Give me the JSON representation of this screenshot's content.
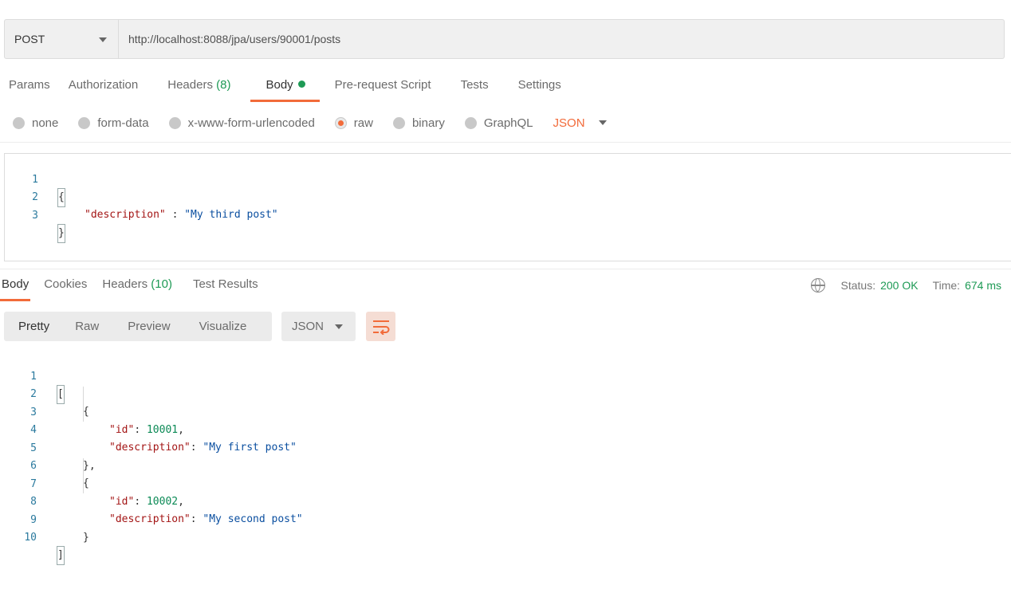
{
  "request": {
    "method": "POST",
    "url": "http://localhost:8088/jpa/users/90001/posts"
  },
  "request_tabs": [
    {
      "label": "Params"
    },
    {
      "label": "Authorization"
    },
    {
      "label": "Headers",
      "count": "(8)"
    },
    {
      "label": "Body"
    },
    {
      "label": "Pre-request Script"
    },
    {
      "label": "Tests"
    },
    {
      "label": "Settings"
    }
  ],
  "body_types": [
    {
      "label": "none"
    },
    {
      "label": "form-data"
    },
    {
      "label": "x-www-form-urlencoded"
    },
    {
      "label": "raw"
    },
    {
      "label": "binary"
    },
    {
      "label": "GraphQL"
    }
  ],
  "body_format": "JSON",
  "request_body": {
    "line_numbers": [
      "1",
      "2",
      "3"
    ],
    "open": "{",
    "key": "\"description\"",
    "sep": " : ",
    "value": "\"My third post\"",
    "close": "}"
  },
  "response_tabs": [
    {
      "label": "Body"
    },
    {
      "label": "Cookies"
    },
    {
      "label": "Headers",
      "count": "(10)"
    },
    {
      "label": "Test Results"
    }
  ],
  "response_meta": {
    "status_label": "Status:",
    "status_value": "200 OK",
    "time_label": "Time:",
    "time_value": "674 ms"
  },
  "view_modes": [
    {
      "label": "Pretty"
    },
    {
      "label": "Raw"
    },
    {
      "label": "Preview"
    },
    {
      "label": "Visualize"
    }
  ],
  "response_format": "JSON",
  "response_body": {
    "line_numbers": [
      "1",
      "2",
      "3",
      "4",
      "5",
      "6",
      "7",
      "8",
      "9",
      "10"
    ],
    "open_arr": "[",
    "open_obj": "{",
    "close_obj_comma": "},",
    "close_obj": "}",
    "close_arr": "]",
    "id_key": "\"id\"",
    "desc_key": "\"description\"",
    "colon": ": ",
    "comma": ",",
    "items": [
      {
        "id": "10001",
        "description": "\"My first post\""
      },
      {
        "id": "10002",
        "description": "\"My second post\""
      }
    ]
  },
  "colors": {
    "accent": "#f26b3a",
    "success": "#1e9a55"
  }
}
